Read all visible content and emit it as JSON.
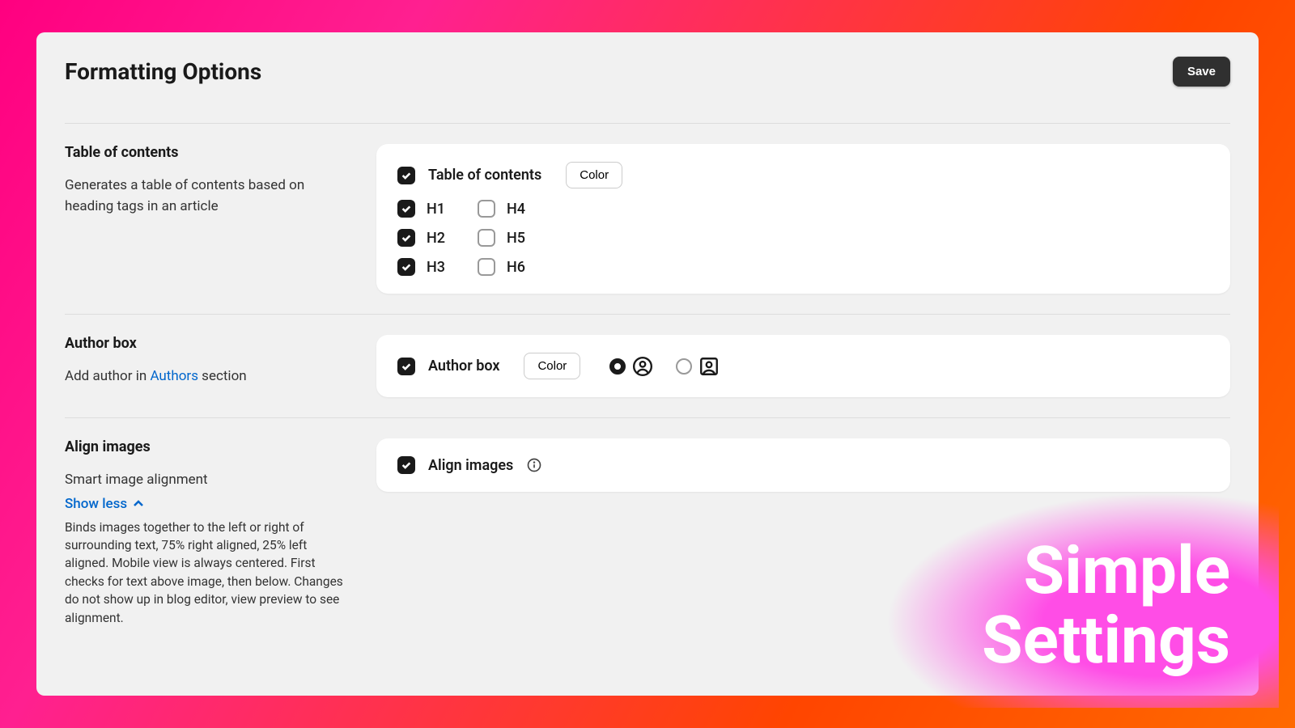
{
  "header": {
    "title": "Formatting Options",
    "save": "Save"
  },
  "toc": {
    "title": "Table of contents",
    "desc": "Generates a table of contents based on heading tags in an article",
    "enable_label": "Table of contents",
    "color_btn": "Color",
    "headings": [
      {
        "label": "H1",
        "checked": true
      },
      {
        "label": "H4",
        "checked": false
      },
      {
        "label": "H2",
        "checked": true
      },
      {
        "label": "H5",
        "checked": false
      },
      {
        "label": "H3",
        "checked": true
      },
      {
        "label": "H6",
        "checked": false
      }
    ]
  },
  "author": {
    "title": "Author box",
    "desc_pre": "Add author in ",
    "desc_link": "Authors",
    "desc_post": " section",
    "enable_label": "Author box",
    "color_btn": "Color"
  },
  "align": {
    "title": "Align images",
    "subtitle": "Smart image alignment",
    "showless": "Show less",
    "detail": "Binds images together to the left or right of surrounding text, 75% right aligned, 25% left aligned. Mobile view is always centered. First checks for text above image, then below. Changes do not show up in blog editor, view preview to see alignment.",
    "enable_label": "Align images"
  },
  "overlay": {
    "line1": "Simple",
    "line2": "Settings"
  }
}
